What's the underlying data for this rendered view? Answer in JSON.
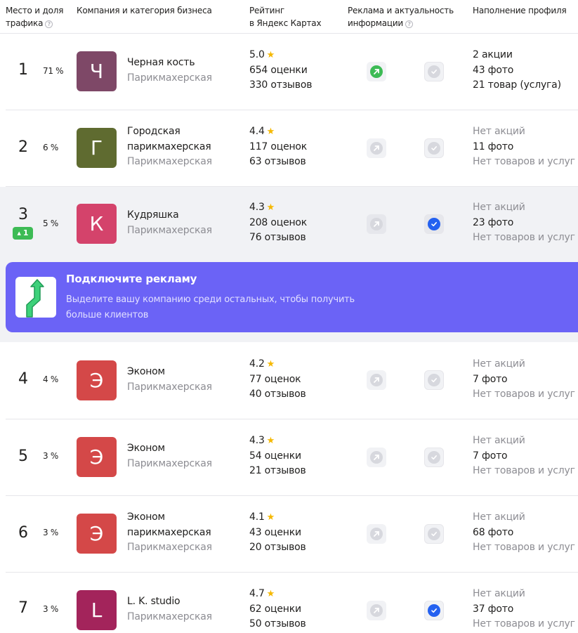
{
  "header": {
    "col_place": "Место и доля",
    "col_place_2": "трафика",
    "col_company": "Компания и категория бизнеса",
    "col_rating": "Рейтинг",
    "col_rating_2": "в Яндекс Картах",
    "col_ads": "Реклама и актуальность",
    "col_ads_2": "информации",
    "col_profile": "Наполнение профиля",
    "hint_glyph": "?"
  },
  "star_glyph": "★",
  "rows": [
    {
      "rank": "1",
      "share": "71 %",
      "letter": "Ч",
      "avatar_color": "#7e4867",
      "name": "Черная кость",
      "name_2": "",
      "category": "Парикмахерская",
      "rating": "5.0",
      "ratings_count": "654 оценки",
      "reviews": "330 отзывов",
      "ad_active": true,
      "checked": false,
      "actions": "2 акции",
      "photos": "43 фото",
      "goods": "21 товар (услуга)"
    },
    {
      "rank": "2",
      "share": "6 %",
      "letter": "Г",
      "avatar_color": "#5f6b30",
      "name": "Городская",
      "name_2": "парикмахерская",
      "category": "Парикмахерская",
      "rating": "4.4",
      "ratings_count": "117 оценок",
      "reviews": "63 отзывов",
      "ad_active": false,
      "checked": false,
      "actions": "Нет акций",
      "photos": "11 фото",
      "goods": "Нет товаров и услуг"
    },
    {
      "rank": "3",
      "share": "5 %",
      "rank_change": "1",
      "letter": "К",
      "avatar_color": "#d4436b",
      "name": "Кудряшка",
      "name_2": "",
      "category": "Парикмахерская",
      "rating": "4.3",
      "ratings_count": "208 оценок",
      "reviews": "76 отзывов",
      "ad_active": false,
      "checked": true,
      "actions": "Нет акций",
      "photos": "23 фото",
      "goods": "Нет товаров и услуг"
    },
    {
      "rank": "4",
      "share": "4 %",
      "letter": "Э",
      "avatar_color": "#d44848",
      "name": "Эконом",
      "name_2": "",
      "category": "Парикмахерская",
      "rating": "4.2",
      "ratings_count": "77 оценок",
      "reviews": "40 отзывов",
      "ad_active": false,
      "checked": false,
      "actions": "Нет акций",
      "photos": "7 фото",
      "goods": "Нет товаров и услуг"
    },
    {
      "rank": "5",
      "share": "3 %",
      "letter": "Э",
      "avatar_color": "#d44848",
      "name": "Эконом",
      "name_2": "",
      "category": "Парикмахерская",
      "rating": "4.3",
      "ratings_count": "54 оценки",
      "reviews": "21 отзывов",
      "ad_active": false,
      "checked": false,
      "actions": "Нет акций",
      "photos": "7 фото",
      "goods": "Нет товаров и услуг"
    },
    {
      "rank": "6",
      "share": "3 %",
      "letter": "Э",
      "avatar_color": "#d44848",
      "name": "Эконом",
      "name_2": "парикмахерская",
      "category": "Парикмахерская",
      "rating": "4.1",
      "ratings_count": "43 оценки",
      "reviews": "20 отзывов",
      "ad_active": false,
      "checked": false,
      "actions": "Нет акций",
      "photos": "68 фото",
      "goods": "Нет товаров и услуг"
    },
    {
      "rank": "7",
      "share": "3 %",
      "letter": "L",
      "avatar_color": "#a3245b",
      "name": "L. K. studio",
      "name_2": "",
      "category": "Парикмахерская",
      "rating": "4.7",
      "ratings_count": "62 оценки",
      "reviews": "50 отзывов",
      "ad_active": false,
      "checked": true,
      "actions": "Нет акций",
      "photos": "37 фото",
      "goods": "Нет товаров и услуг"
    }
  ],
  "promo": {
    "title": "Подключите рекламу",
    "text": "Выделите вашу компанию среди остальных, чтобы получить больше клиентов",
    "accent": "#6b63f6"
  }
}
